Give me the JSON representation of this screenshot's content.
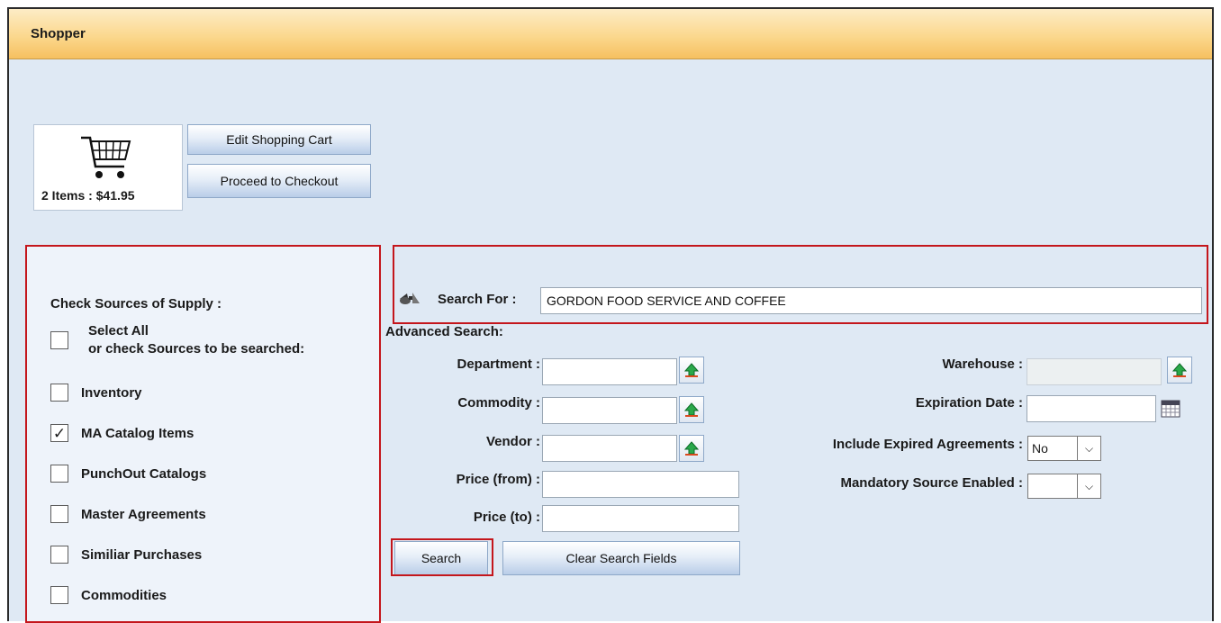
{
  "window": {
    "title": "Shopper"
  },
  "cart": {
    "icon": "shopping-cart-icon",
    "summary": "2 Items : $41.95",
    "edit_label": "Edit Shopping Cart",
    "checkout_label": "Proceed to Checkout"
  },
  "sources": {
    "heading": "Check Sources of Supply :",
    "select_all_line1": "Select All",
    "select_all_line2": "or check Sources to be searched:",
    "items": [
      {
        "label": "Inventory",
        "checked": false
      },
      {
        "label": "MA Catalog Items",
        "checked": true
      },
      {
        "label": "PunchOut Catalogs",
        "checked": false
      },
      {
        "label": "Master Agreements",
        "checked": false
      },
      {
        "label": "Similiar Purchases",
        "checked": false
      },
      {
        "label": "Commodities",
        "checked": false
      }
    ]
  },
  "search": {
    "icon": "binoculars-icon",
    "label": "Search For :",
    "value": "GORDON FOOD SERVICE AND COFFEE"
  },
  "advanced": {
    "heading": "Advanced Search:",
    "department_label": "Department :",
    "commodity_label": "Commodity :",
    "vendor_label": "Vendor :",
    "price_from_label": "Price (from) :",
    "price_to_label": "Price (to) :",
    "warehouse_label": "Warehouse :",
    "expiration_label": "Expiration Date :",
    "include_expired_label": "Include Expired Agreements :",
    "include_expired_value": "No",
    "mandatory_label": "Mandatory Source Enabled :",
    "mandatory_value": ""
  },
  "actions": {
    "search_label": "Search",
    "clear_label": "Clear Search Fields"
  },
  "colors": {
    "highlight": "#c4161c",
    "titlebar": "#fbd88e",
    "background": "#dfe9f4"
  }
}
